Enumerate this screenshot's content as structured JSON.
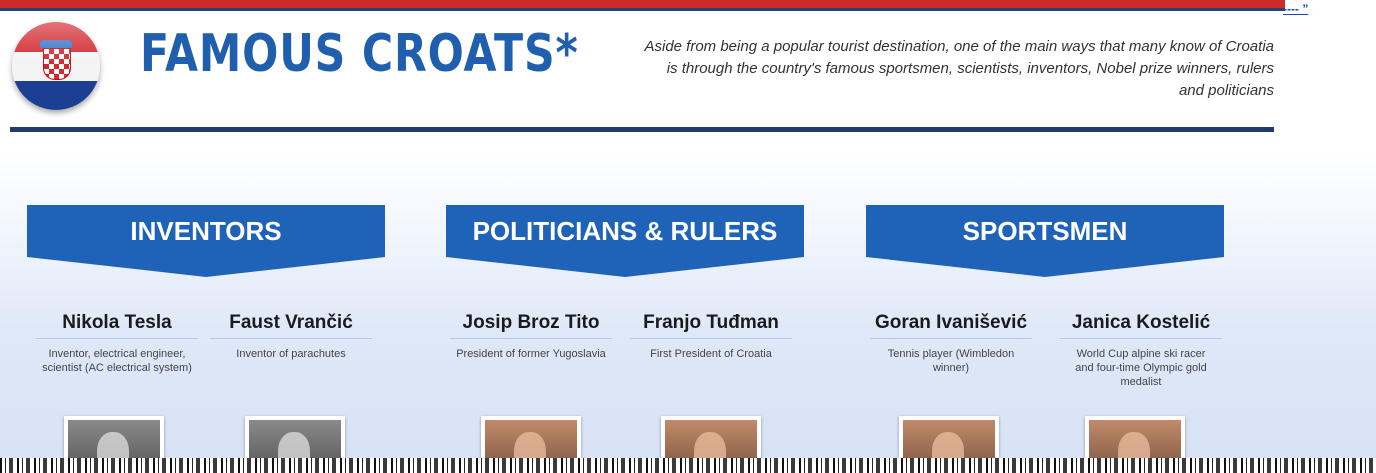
{
  "header": {
    "title": "FAMOUS CROATS*",
    "intro": "Aside from being a popular tourist destination,  one of the main ways that many know of Croatia is through the country's famous sportsmen, scientists, inventors, Nobel prize winners, rulers and politicians",
    "corner_text": "‐‐‐‐ ”",
    "flag_icon": "croatia-flag-icon"
  },
  "colors": {
    "accent": "#1f63b8",
    "title": "#1f5fae",
    "rule": "#1e3d6e",
    "top_red": "#cf2a2a"
  },
  "sections": [
    {
      "label": "INVENTORS",
      "people": [
        {
          "name": "Nikola Tesla",
          "desc": "Inventor, electrical engineer, scientist (AC electrical system)"
        },
        {
          "name": "Faust Vrančić",
          "desc": "Inventor of parachutes"
        }
      ]
    },
    {
      "label": "POLITICIANS & RULERS",
      "people": [
        {
          "name": "Josip Broz Tito",
          "desc": "President of former Yugoslavia"
        },
        {
          "name": "Franjo Tuđman",
          "desc": "First President of Croatia"
        }
      ]
    },
    {
      "label": "SPORTSMEN",
      "people": [
        {
          "name": "Goran Ivanišević",
          "desc": "Tennis player (Wimbledon winner)"
        },
        {
          "name": "Janica Kostelić",
          "desc": "World Cup alpine ski racer and four-time Olympic gold medalist"
        }
      ]
    }
  ]
}
